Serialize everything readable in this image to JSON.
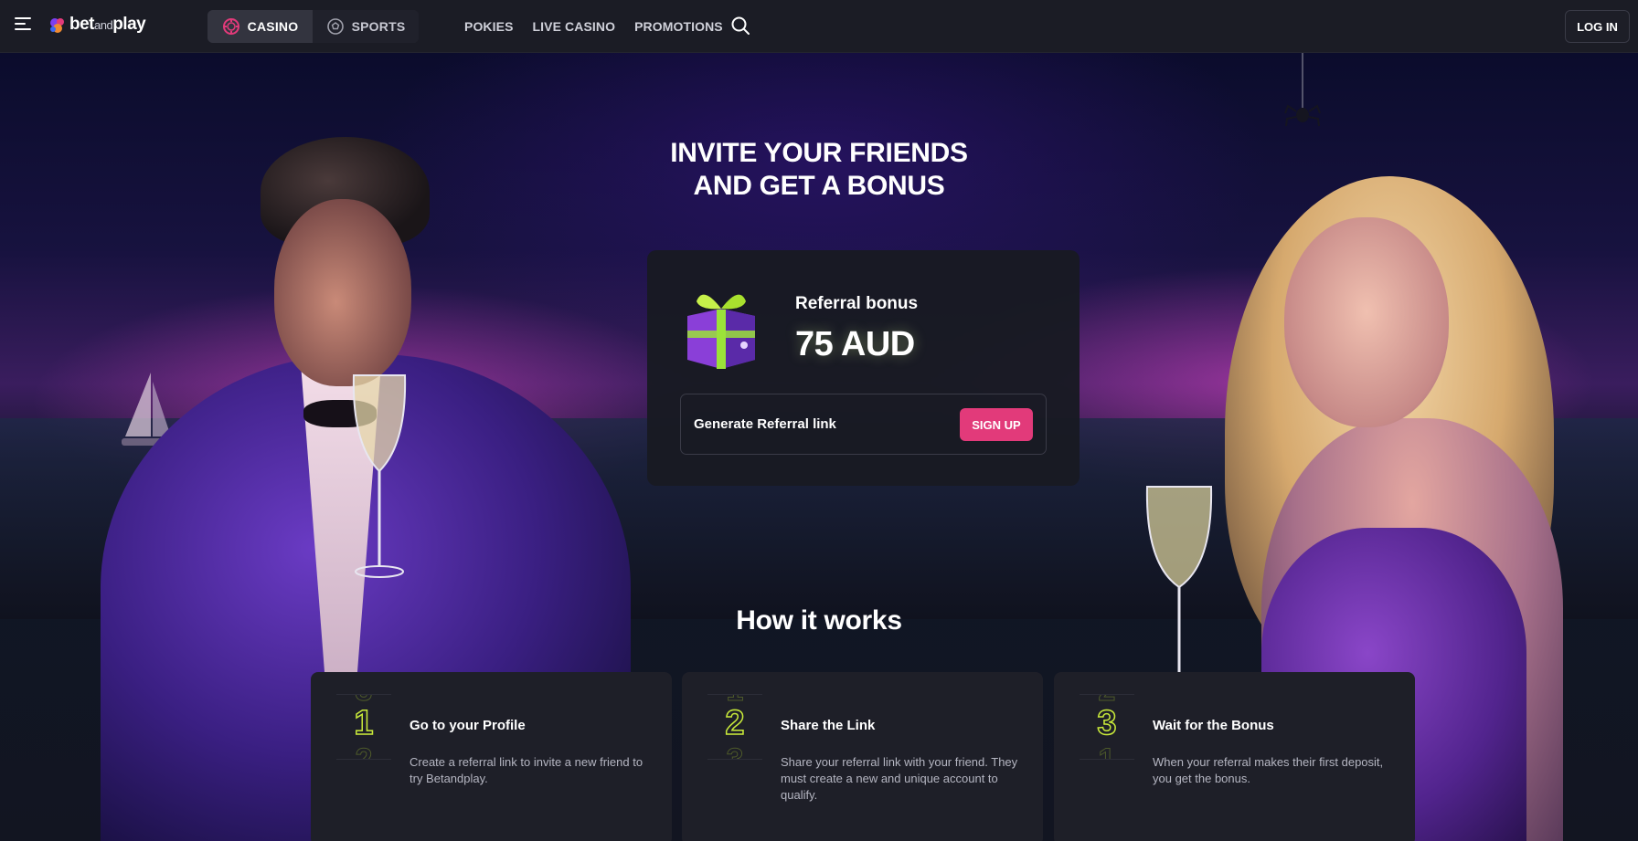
{
  "header": {
    "logo": {
      "prefix": "bet",
      "middle": "and",
      "suffix": "play"
    },
    "switcher": {
      "casino_label": "CASINO",
      "sports_label": "SPORTS",
      "active": "casino"
    },
    "nav": [
      "POKIES",
      "LIVE CASINO",
      "PROMOTIONS"
    ],
    "login_label": "LOG IN"
  },
  "hero": {
    "title": "INVITE YOUR FRIENDS AND GET A BONUS"
  },
  "bonus": {
    "label": "Referral bonus",
    "amount": "75 AUD",
    "generate_label": "Generate Referral link",
    "signup_label": "SIGN UP"
  },
  "how": {
    "title": "How it works",
    "steps": [
      {
        "number": "1",
        "title": "Go to your Profile",
        "text": "Create a referral link to invite a new friend to try Betandplay."
      },
      {
        "number": "2",
        "title": "Share the Link",
        "text": "Share your referral link with your friend. They must create a new and unique account to qualify."
      },
      {
        "number": "3",
        "title": "Wait for the Bonus",
        "text": "When your referral makes their first deposit, you get the bonus."
      }
    ]
  },
  "colors": {
    "accent_pink": "#e23a7a",
    "accent_lime": "#c9ea3a",
    "header_bg": "#1b1c25",
    "card_bg": "#1e1f28"
  }
}
